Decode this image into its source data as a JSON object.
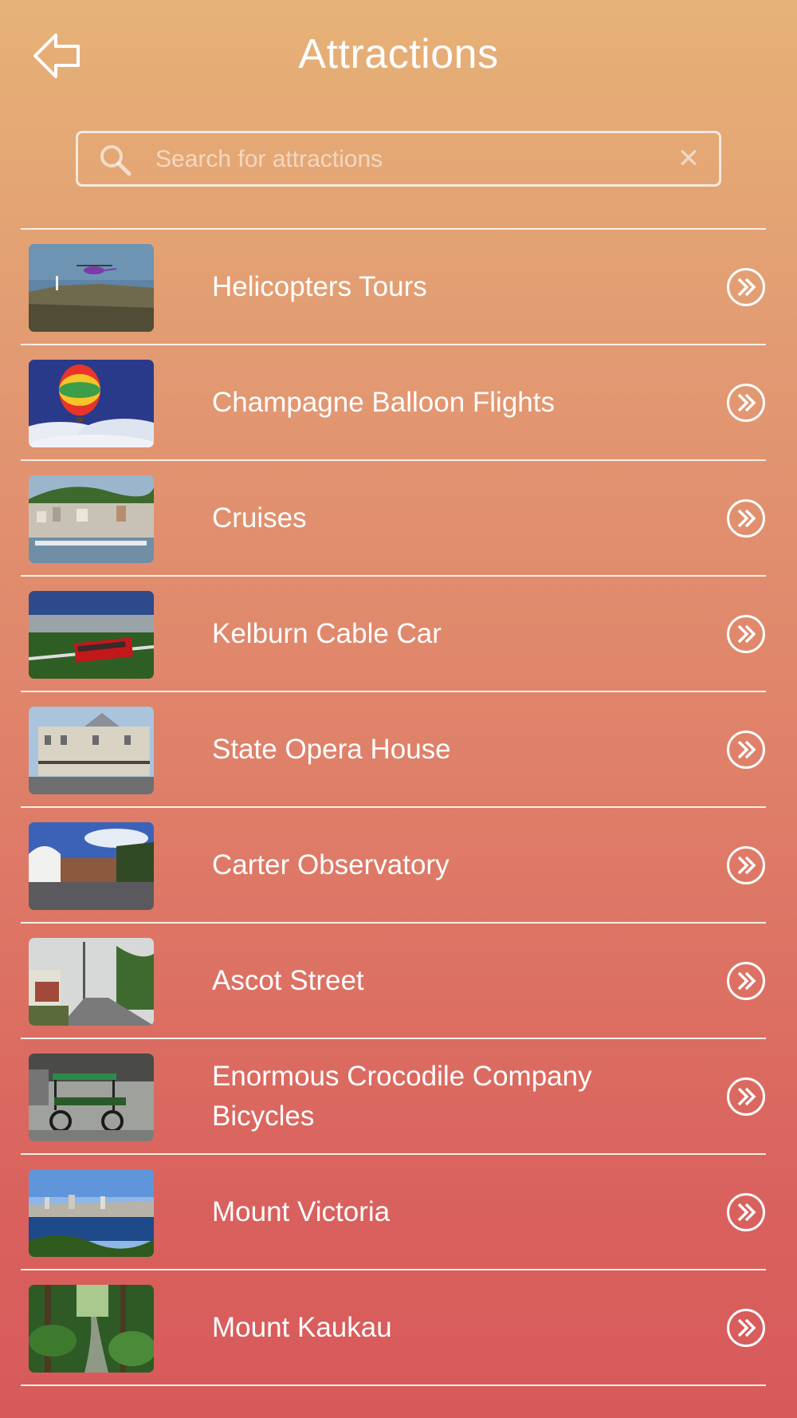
{
  "header": {
    "title": "Attractions",
    "back_icon": "back-arrow-icon"
  },
  "search": {
    "placeholder": "Search for attractions",
    "value": "",
    "search_icon": "search-icon",
    "clear_icon": "clear-icon"
  },
  "attractions": [
    {
      "label": "Helicopters Tours",
      "image": "helicopter-photo"
    },
    {
      "label": "Champagne Balloon Flights",
      "image": "balloon-photo"
    },
    {
      "label": "Cruises",
      "image": "harbour-photo"
    },
    {
      "label": "Kelburn Cable Car",
      "image": "cable-car-photo"
    },
    {
      "label": "State Opera House",
      "image": "opera-house-photo"
    },
    {
      "label": "Carter Observatory",
      "image": "observatory-photo"
    },
    {
      "label": "Ascot Street",
      "image": "street-photo"
    },
    {
      "label": "Enormous Crocodile Company Bicycles",
      "image": "bicycles-photo"
    },
    {
      "label": "Mount Victoria",
      "image": "city-view-photo"
    },
    {
      "label": "Mount Kaukau",
      "image": "forest-photo"
    }
  ],
  "colors": {
    "gradient_top": "#e6b277",
    "gradient_bottom": "#d75a5b",
    "line": "#f8eee6"
  }
}
